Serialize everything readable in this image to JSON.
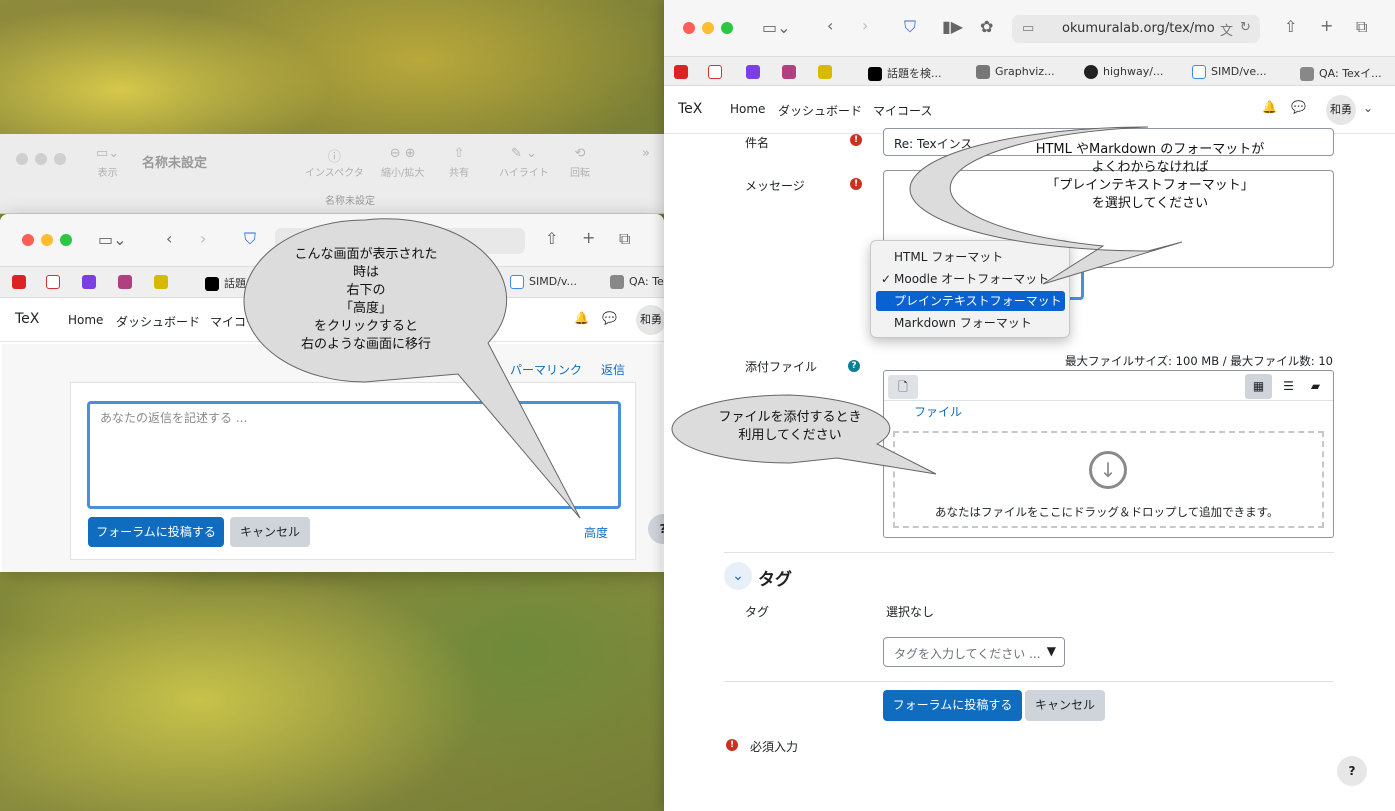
{
  "preview": {
    "title": "名称未設定",
    "filename": "名称未設定",
    "tools": [
      "表示",
      "インスペクタ",
      "縮小/拡大",
      "共有",
      "ハイライト",
      "回転"
    ]
  },
  "small_window": {
    "tabs": [
      "話題を",
      "SIMD/v...",
      "QA: Te"
    ],
    "nav": {
      "brand": "TeX",
      "items": [
        "Home",
        "ダッシュボード",
        "マイコー"
      ],
      "avatar": "和勇"
    },
    "permalink": "パーマリンク",
    "reply": "返信",
    "placeholder": "あなたの返信を記述する ...",
    "post_button": "フォーラムに投稿する",
    "cancel_button": "キャンセル",
    "advanced_link": "高度",
    "help": "?"
  },
  "big_window": {
    "url": "okumuralab.org/tex/mo",
    "tabs": [
      "話題を検...",
      "Graphviz...",
      "highway/...",
      "SIMD/ve...",
      "QA: Texイ..."
    ],
    "nav": {
      "brand": "TeX",
      "items": [
        "Home",
        "ダッシュボード",
        "マイコース"
      ],
      "avatar": "和勇"
    },
    "subject_label": "件名",
    "subject_value": "Re: Texインス",
    "message_label": "メッセージ",
    "format_menu": [
      {
        "label": "HTML フォーマット",
        "checked": false,
        "selected": false
      },
      {
        "label": "Moodle オートフォーマット",
        "checked": true,
        "selected": false
      },
      {
        "label": "プレインテキストフォーマット",
        "checked": false,
        "selected": true
      },
      {
        "label": "Markdown フォーマット",
        "checked": false,
        "selected": false
      }
    ],
    "attach_label": "添付ファイル",
    "max_size": "最大ファイルサイズ: 100 MB / 最大ファイル数: 10",
    "files_link": "ファイル",
    "drop_text": "あなたはファイルをここにドラッグ＆ドロップして追加できます。",
    "tags_section": "タグ",
    "tags_label": "タグ",
    "tags_none": "選択なし",
    "tags_placeholder": "タグを入力してください ...",
    "post_button": "フォーラムに投稿する",
    "cancel_button": "キャンセル",
    "required": "必須入力",
    "help": "?"
  },
  "callouts": {
    "left": "こんな画面が表示された\n時は\n右下の\n「高度」\nをクリックすると\n右のような画面に移行",
    "format": "HTML やMarkdown のフォーマットが\nよくわからなければ\n「プレインテキストフォーマット」\nを選択してください",
    "file": "ファイルを添付するとき\n利用してください"
  }
}
